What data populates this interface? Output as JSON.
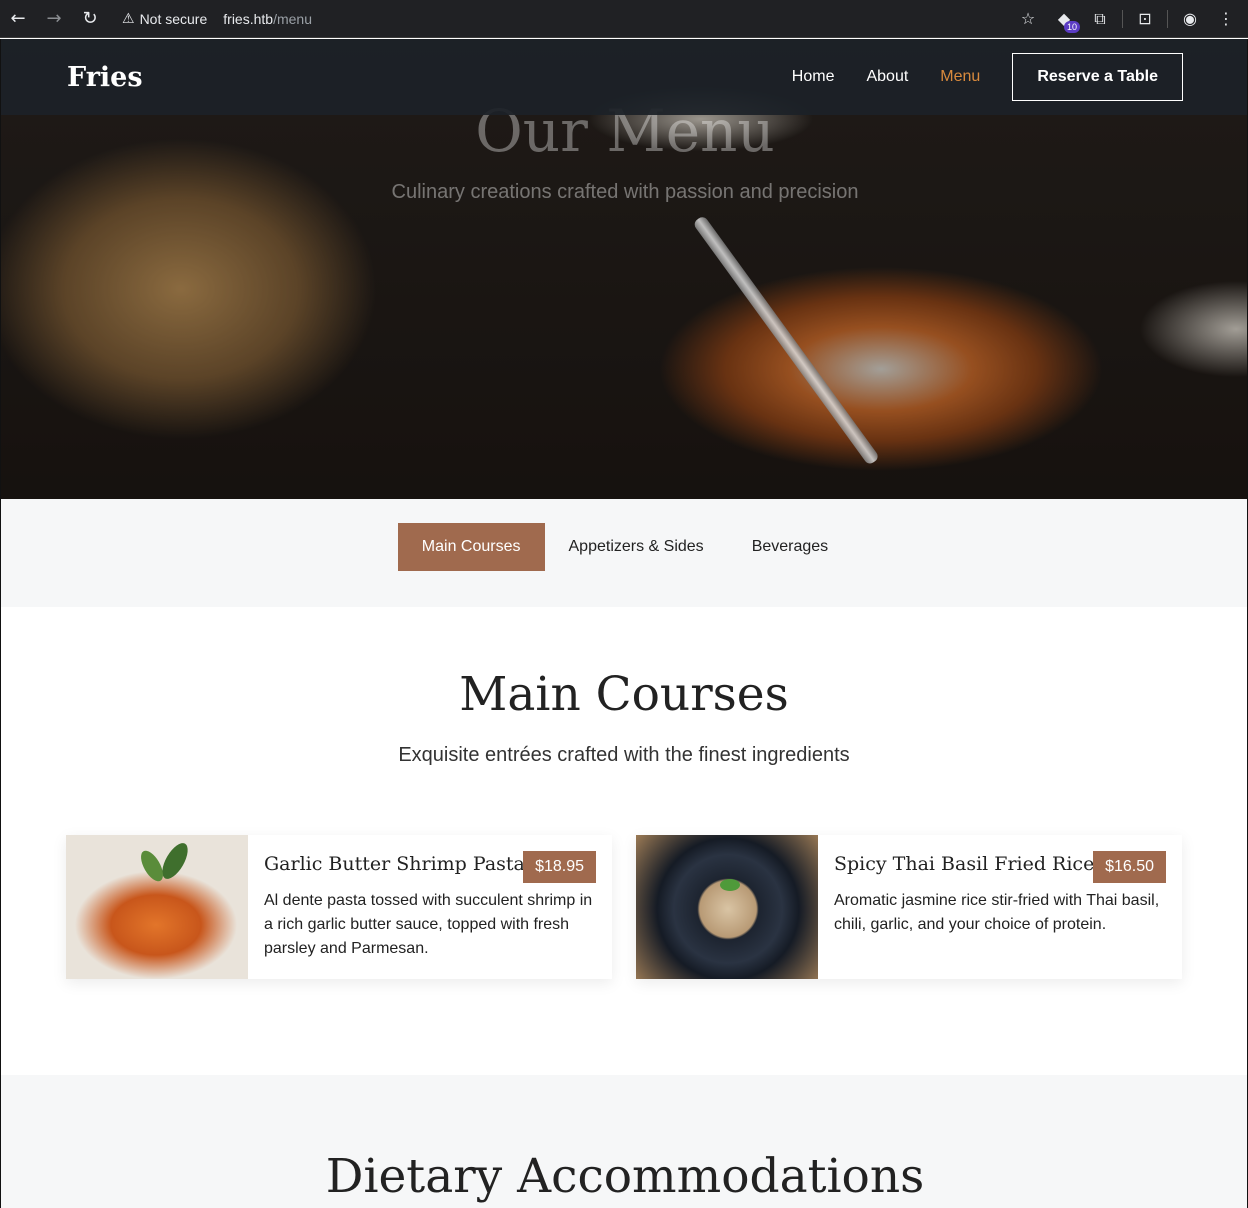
{
  "browser": {
    "security_label": "Not secure",
    "url_host": "fries.htb",
    "url_path": "/menu",
    "extension_badge": "10"
  },
  "nav": {
    "brand": "Fries",
    "links": [
      "Home",
      "About",
      "Menu"
    ],
    "active": "Menu",
    "cta": "Reserve a Table"
  },
  "hero": {
    "title": "Our Menu",
    "subtitle": "Culinary creations crafted with passion and precision"
  },
  "tabs": [
    "Main Courses",
    "Appetizers & Sides",
    "Beverages"
  ],
  "section": {
    "title": "Main Courses",
    "subtitle": "Exquisite entrées crafted with the finest ingredients"
  },
  "items": [
    {
      "name": "Garlic Butter Shrimp Pasta",
      "price": "$18.95",
      "description": "Al dente pasta tossed with succulent shrimp in a rich garlic butter sauce, topped with fresh parsley and Parmesan."
    },
    {
      "name": "Spicy Thai Basil Fried Rice",
      "price": "$16.50",
      "description": "Aromatic jasmine rice stir-fried with Thai basil, chili, garlic, and your choice of protein."
    }
  ],
  "next_section": {
    "title": "Dietary Accommodations"
  },
  "colors": {
    "accent": "#a06a4e",
    "nav_active": "#d98a3d",
    "nav_bg": "#1c2128"
  }
}
